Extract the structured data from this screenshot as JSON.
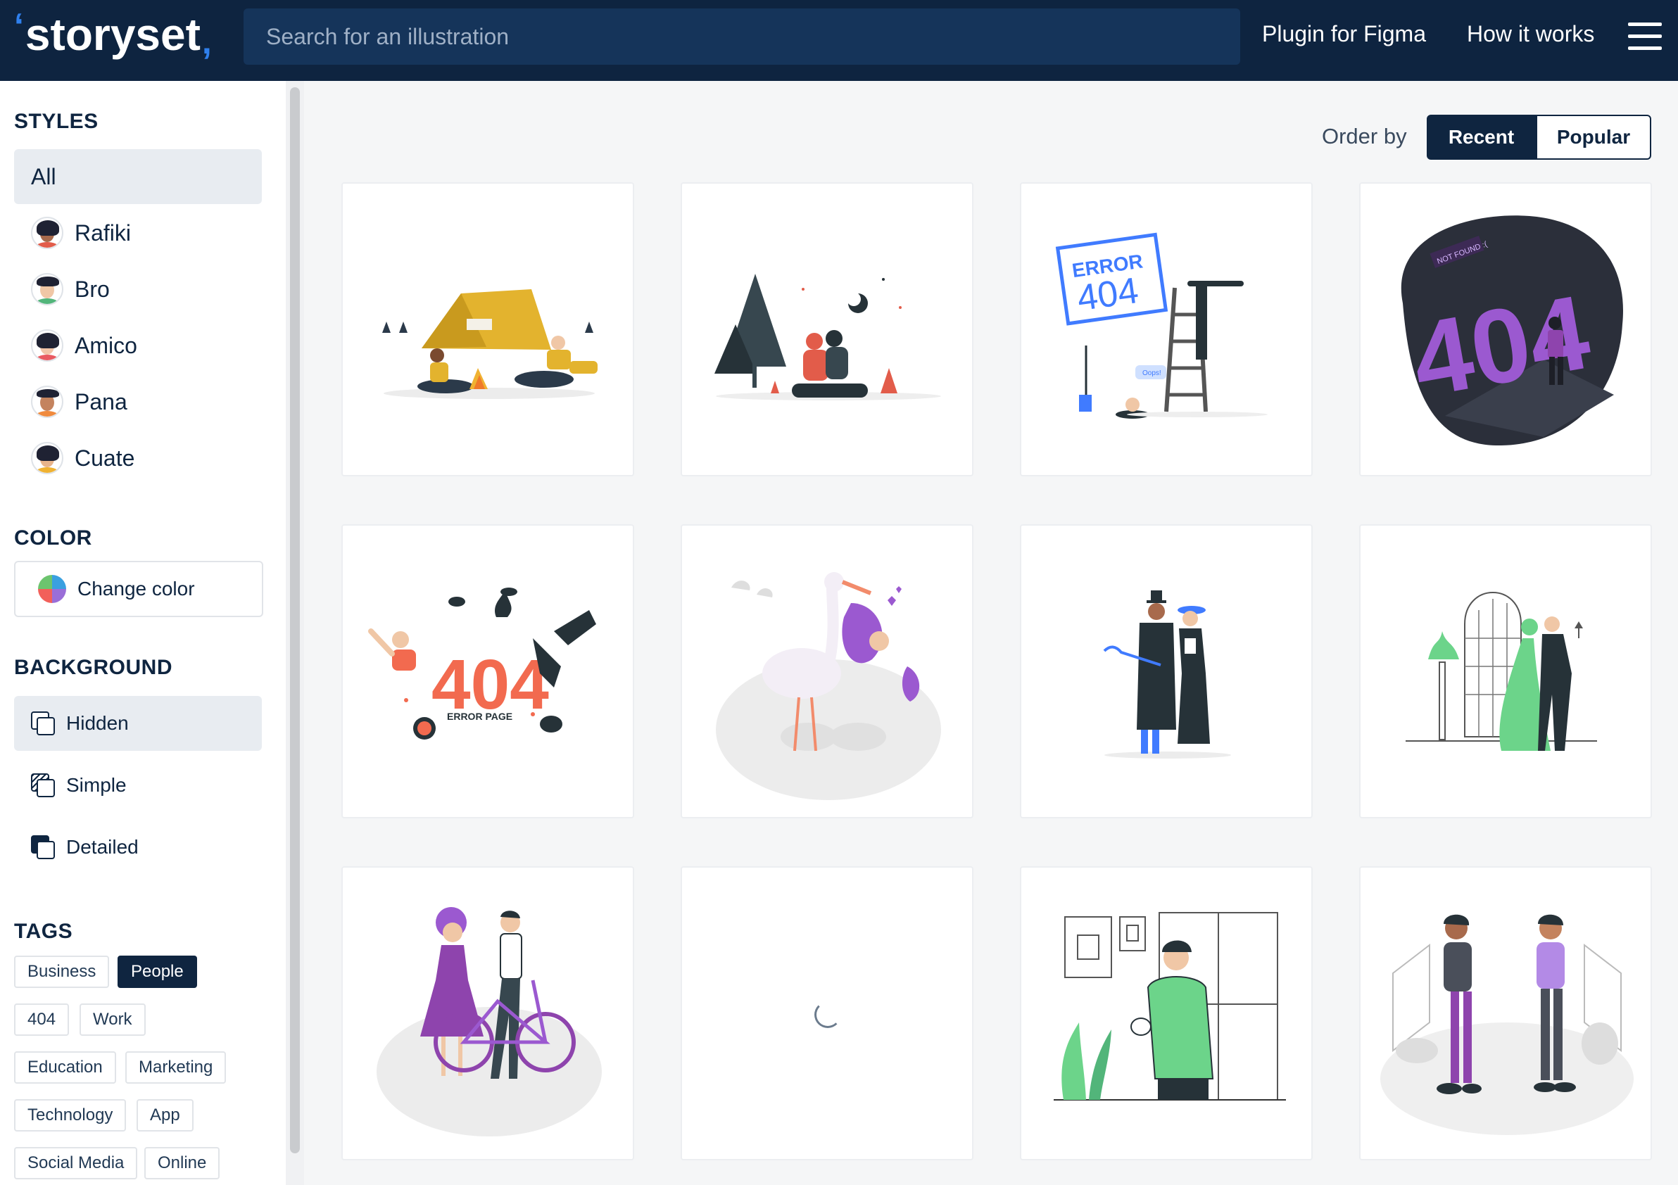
{
  "header": {
    "logo_text": "storyset",
    "search_placeholder": "Search for an illustration",
    "nav": {
      "figma": "Plugin for Figma",
      "how": "How it works"
    }
  },
  "sidebar": {
    "styles_title": "STYLES",
    "styles": [
      {
        "label": "All",
        "active": true
      },
      {
        "label": "Rafiki",
        "skin": "#a86a4c",
        "shirt": "#e25c4a"
      },
      {
        "label": "Bro",
        "skin": "#f0c7a6",
        "shirt": "#52b57a"
      },
      {
        "label": "Amico",
        "skin": "#f1c4a8",
        "shirt": "#e95a62"
      },
      {
        "label": "Pana",
        "skin": "#c4835e",
        "shirt": "#f08a3d"
      },
      {
        "label": "Cuate",
        "skin": "#e8b48b",
        "shirt": "#f0b232"
      }
    ],
    "color_title": "COLOR",
    "change_color": "Change color",
    "background_title": "BACKGROUND",
    "backgrounds": [
      {
        "label": "Hidden",
        "active": true,
        "icon": "hidden-bg-icon"
      },
      {
        "label": "Simple",
        "icon": "simple-bg-icon"
      },
      {
        "label": "Detailed",
        "icon": "detailed-bg-icon"
      }
    ],
    "tags_title": "TAGS",
    "tags": [
      {
        "label": "Business"
      },
      {
        "label": "People",
        "active": true
      },
      {
        "label": "404"
      },
      {
        "label": "Work"
      },
      {
        "label": "Education"
      },
      {
        "label": "Marketing"
      },
      {
        "label": "Technology"
      },
      {
        "label": "App"
      },
      {
        "label": "Social Media"
      },
      {
        "label": "Online"
      }
    ]
  },
  "main": {
    "order_label": "Order by",
    "order_options": [
      "Recent",
      "Popular"
    ],
    "order_selected": "Recent",
    "cards": [
      {
        "name": "camping-tent-illustration"
      },
      {
        "name": "night-campfire-couple-illustration"
      },
      {
        "name": "error-404-ladder-illustration",
        "text": [
          "ERROR",
          "404",
          "Oops!"
        ]
      },
      {
        "name": "404-purple-3d-illustration",
        "text": [
          "404",
          "NOT FOUND :("
        ]
      },
      {
        "name": "404-error-page-illustration",
        "text": [
          "404",
          "ERROR PAGE"
        ]
      },
      {
        "name": "stork-baby-delivery-illustration"
      },
      {
        "name": "victorian-couple-illustration"
      },
      {
        "name": "dancing-couple-illustration"
      },
      {
        "name": "couple-with-bicycle-illustration"
      },
      {
        "name": "loading-card",
        "loading": true
      },
      {
        "name": "man-cleaning-hands-illustration"
      },
      {
        "name": "people-sneezing-illustration"
      }
    ]
  }
}
